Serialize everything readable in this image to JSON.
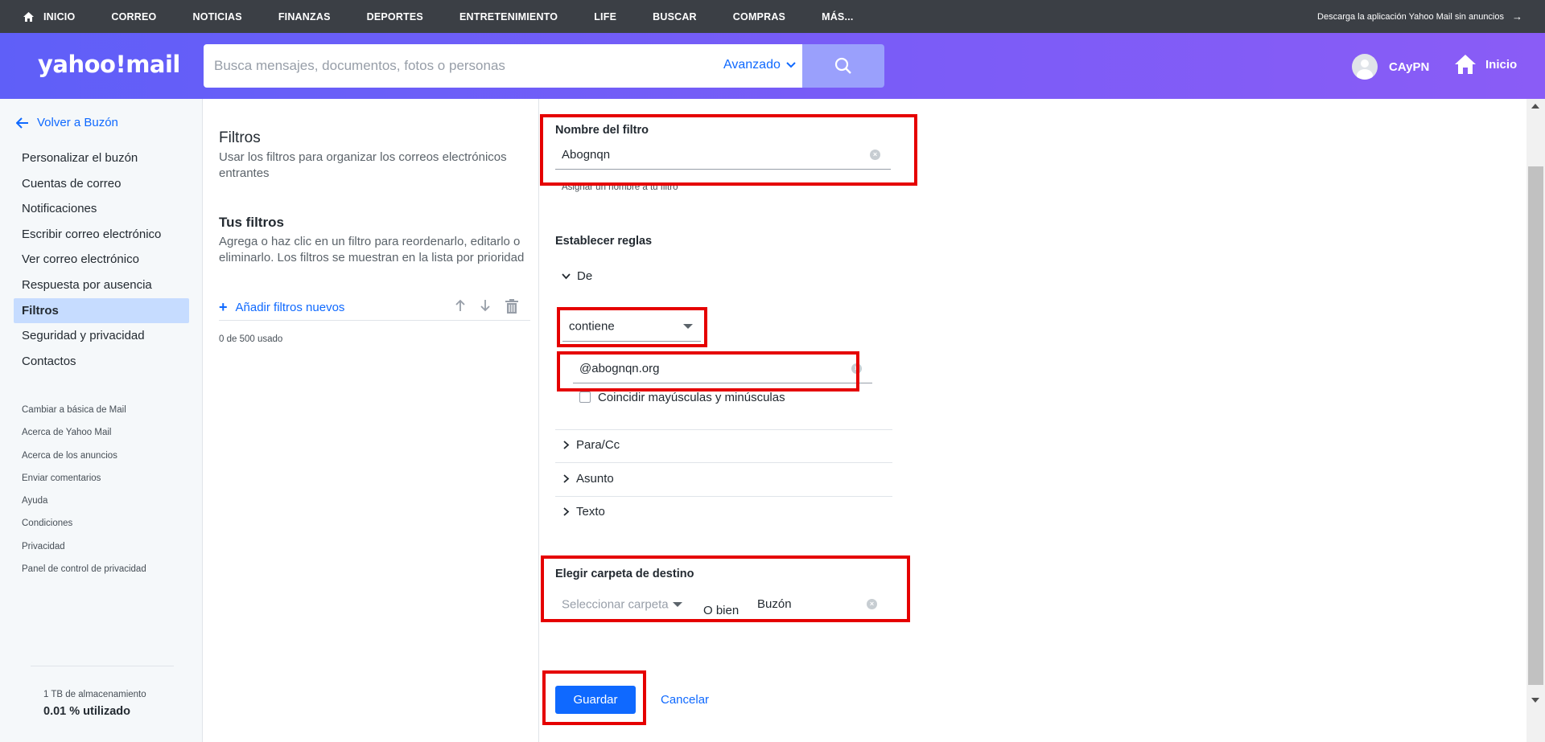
{
  "topnav": {
    "items": [
      "INICIO",
      "CORREO",
      "NOTICIAS",
      "FINANZAS",
      "DEPORTES",
      "ENTRETENIMIENTO",
      "LIFE",
      "BUSCAR",
      "COMPRAS",
      "MÁS..."
    ],
    "promo": "Descarga la aplicación Yahoo Mail sin anuncios"
  },
  "header": {
    "logo": "yahoo!mail",
    "search_placeholder": "Busca mensajes, documentos, fotos o personas",
    "advanced_label": "Avanzado",
    "user_name": "CAyPN",
    "home_label": "Inicio"
  },
  "sidebar": {
    "back_label": "Volver a Buzón",
    "items": [
      {
        "label": "Personalizar el buzón",
        "active": false
      },
      {
        "label": "Cuentas de correo",
        "active": false
      },
      {
        "label": "Notificaciones",
        "active": false
      },
      {
        "label": "Escribir correo electrónico",
        "active": false
      },
      {
        "label": "Ver correo electrónico",
        "active": false
      },
      {
        "label": "Respuesta por ausencia",
        "active": false
      },
      {
        "label": "Filtros",
        "active": true
      },
      {
        "label": "Seguridad y privacidad",
        "active": false
      },
      {
        "label": "Contactos",
        "active": false
      }
    ],
    "links": [
      "Cambiar a básica de Mail",
      "Acerca de Yahoo Mail",
      "Acerca de los anuncios",
      "Enviar comentarios",
      "Ayuda",
      "Condiciones",
      "Privacidad",
      "Panel de control de privacidad"
    ],
    "storage_total": "1 TB de almacenamiento",
    "storage_used": "0.01 % utilizado"
  },
  "filters_panel": {
    "title": "Filtros",
    "description": "Usar los filtros para organizar los correos electrónicos entrantes",
    "your_filters_title": "Tus filtros",
    "your_filters_description": "Agrega o haz clic en un filtro para reordenarlo, editarlo o eliminarlo. Los filtros se muestran en la lista por prioridad",
    "add_label": "Añadir filtros nuevos",
    "usage": "0 de 500 usado"
  },
  "form": {
    "name_label": "Nombre del filtro",
    "name_value": "Abognqn",
    "name_hint": "Asignar un nombre a tu filtro",
    "rules_label": "Establecer reglas",
    "rule_from": "De",
    "condition_value": "contiene",
    "from_value": "@abognqn.org",
    "match_case_label": "Coincidir mayúsculas y minúsculas",
    "rule_to_cc": "Para/Cc",
    "rule_subject": "Asunto",
    "rule_body": "Texto",
    "dest_label": "Elegir carpeta de destino",
    "folder_placeholder": "Seleccionar carpeta",
    "or_label": "O bien",
    "new_folder_value": "Buzón",
    "save_label": "Guardar",
    "cancel_label": "Cancelar"
  },
  "colors": {
    "accent": "#0f69ff",
    "highlight_box": "#e50000",
    "header_gradient_start": "#5f5ff8",
    "header_gradient_end": "#8a5cf6",
    "active_item": "#c6dcff"
  }
}
